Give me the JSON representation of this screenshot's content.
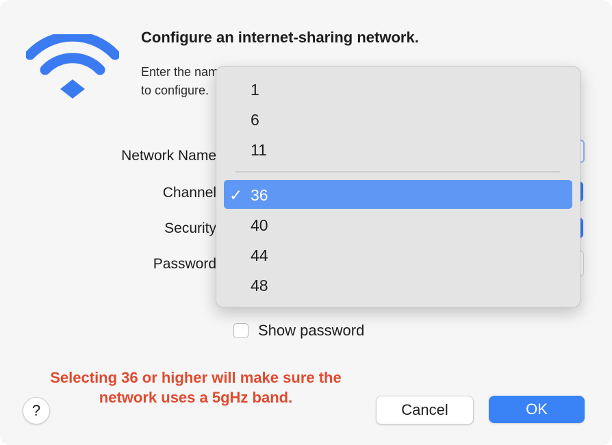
{
  "dialog": {
    "title": "Configure an internet-sharing network.",
    "description_line1": "Enter the name and password of the network you want",
    "description_line2": "to configure.",
    "icon": "wifi-icon",
    "accent_color": "#3a7bf2"
  },
  "form": {
    "network_name_label": "Network Name",
    "channel_label": "Channel",
    "security_label": "Security",
    "password_label": "Password"
  },
  "channel_menu": {
    "group1": [
      "1",
      "6",
      "11"
    ],
    "group2": [
      "36",
      "40",
      "44",
      "48"
    ],
    "selected": "36",
    "check_mark": "✓"
  },
  "show_password": {
    "label": "Show password",
    "checked": false
  },
  "annotation": {
    "line1": "Selecting 36 or higher will make sure the",
    "line2": "network uses a 5gHz band.",
    "color": "#e04a2f"
  },
  "buttons": {
    "help": "?",
    "cancel": "Cancel",
    "ok": "OK"
  }
}
